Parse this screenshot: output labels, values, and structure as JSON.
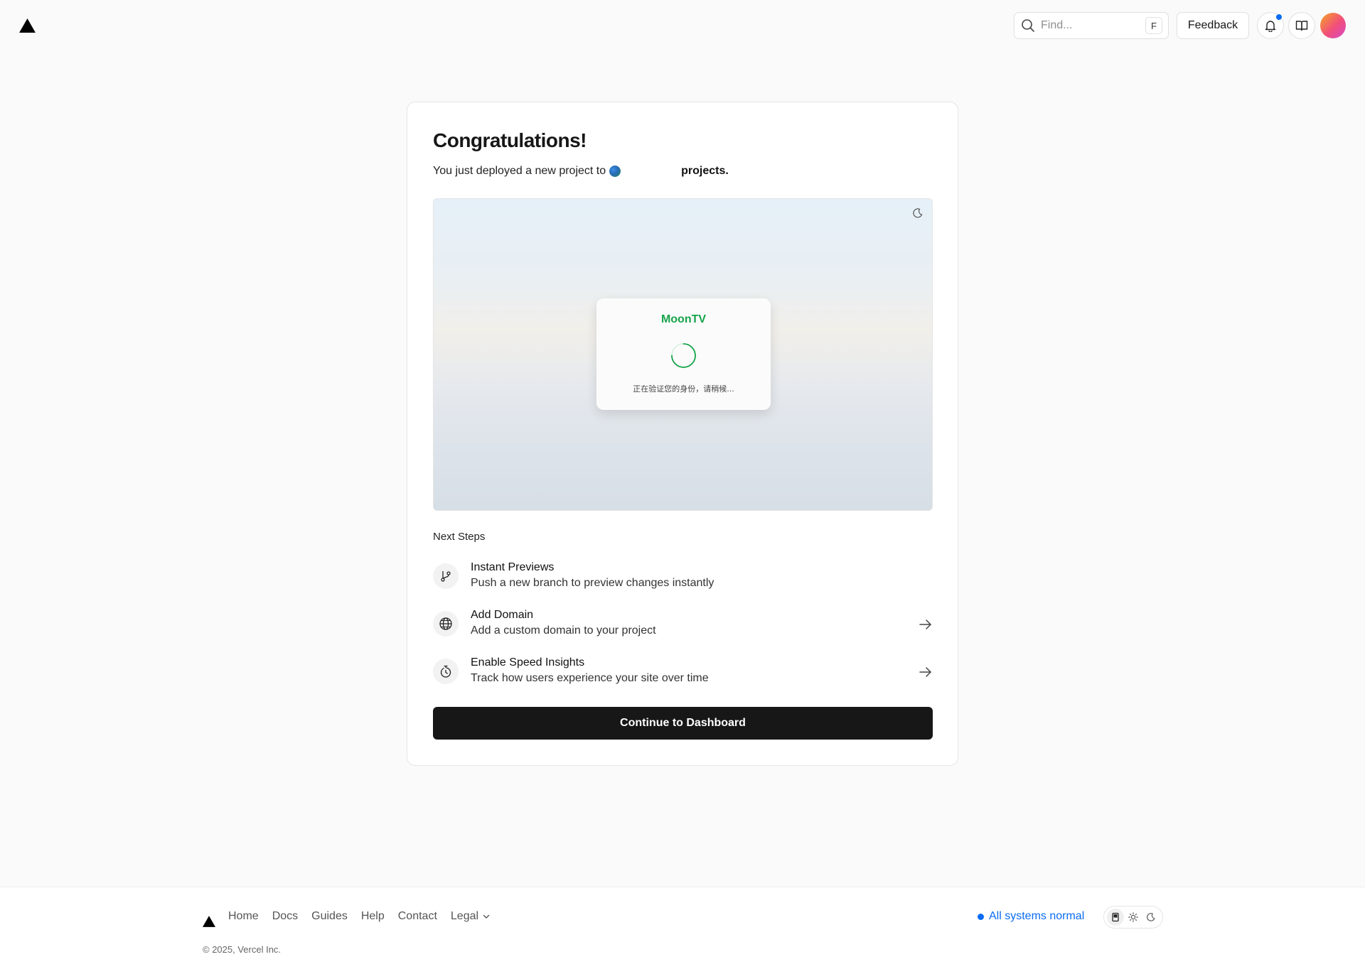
{
  "header": {
    "search_placeholder": "Find...",
    "search_shortcut": "F",
    "feedback_label": "Feedback"
  },
  "card": {
    "title": "Congratulations!",
    "subtitle_prefix": "You just deployed a new project to",
    "subtitle_suffix": "projects.",
    "preview": {
      "app_name": "MoonTV",
      "loading_text": "正在验证您的身份，请稍候..."
    },
    "next_steps_label": "Next Steps",
    "steps": [
      {
        "title": "Instant Previews",
        "description": "Push a new branch to preview changes instantly",
        "icon": "git-branch-icon"
      },
      {
        "title": "Add Domain",
        "description": "Add a custom domain to your project",
        "icon": "globe-icon"
      },
      {
        "title": "Enable Speed Insights",
        "description": "Track how users experience your site over time",
        "icon": "stopwatch-icon"
      }
    ],
    "continue_label": "Continue to Dashboard"
  },
  "footer": {
    "links": [
      "Home",
      "Docs",
      "Guides",
      "Help",
      "Contact",
      "Legal"
    ],
    "copyright": "© 2025, Vercel Inc.",
    "status": "All systems normal"
  },
  "colors": {
    "accent_blue": "#0a6cf2",
    "brand_green": "#16a34a",
    "button_dark": "#171717"
  }
}
